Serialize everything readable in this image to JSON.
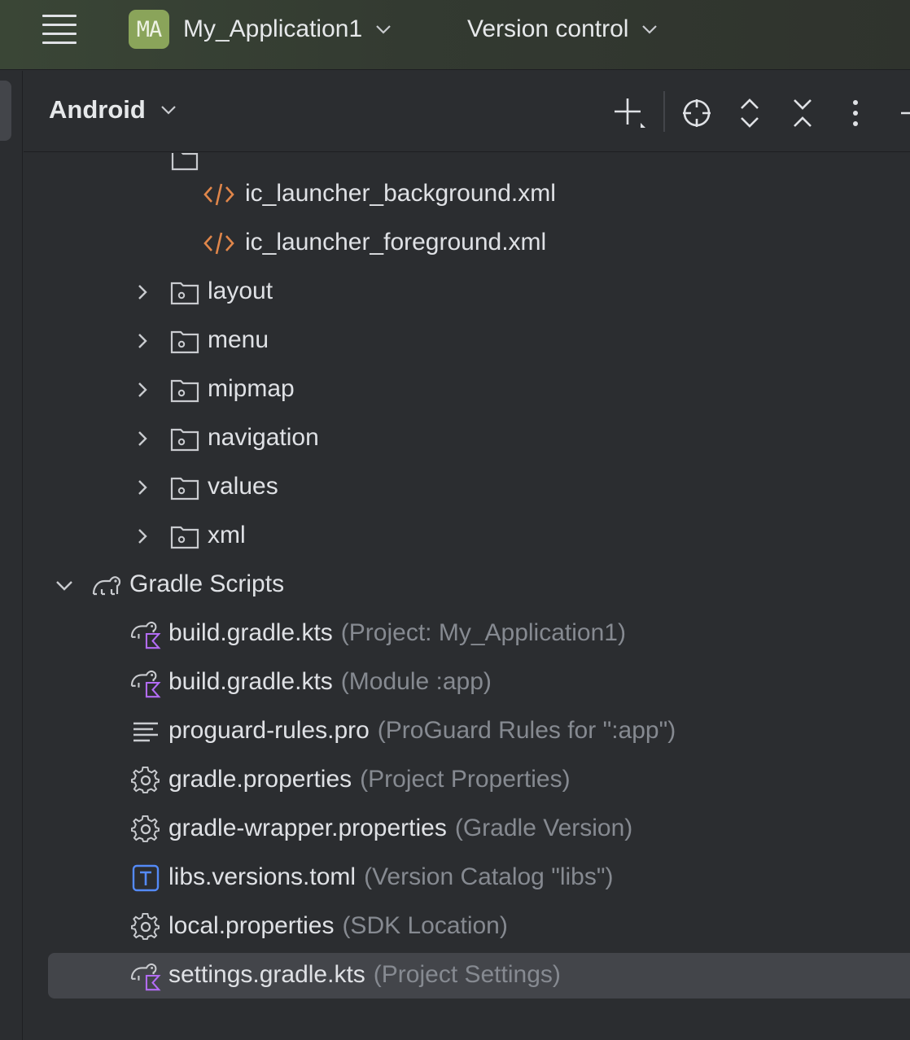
{
  "titlebar": {
    "project_badge": "MA",
    "project_name": "My_Application1",
    "vcs_label": "Version control",
    "background": "#35402f"
  },
  "panel": {
    "view_mode": "Android",
    "tools": [
      "add-icon",
      "locate-icon",
      "expand-collapse-icon",
      "collapse-all-icon",
      "more-icon",
      "minimize-icon"
    ]
  },
  "tree": {
    "items": [
      {
        "label": "ic_launcher_background.xml",
        "hint": "",
        "icon": "xml-icon",
        "expandable": false
      },
      {
        "label": "ic_launcher_foreground.xml",
        "hint": "",
        "icon": "xml-icon",
        "expandable": false
      },
      {
        "label": "layout",
        "hint": "",
        "icon": "res-folder-icon",
        "expandable": true,
        "expanded": false
      },
      {
        "label": "menu",
        "hint": "",
        "icon": "res-folder-icon",
        "expandable": true,
        "expanded": false
      },
      {
        "label": "mipmap",
        "hint": "",
        "icon": "res-folder-icon",
        "expandable": true,
        "expanded": false
      },
      {
        "label": "navigation",
        "hint": "",
        "icon": "res-folder-icon",
        "expandable": true,
        "expanded": false
      },
      {
        "label": "values",
        "hint": "",
        "icon": "res-folder-icon",
        "expandable": true,
        "expanded": false
      },
      {
        "label": "xml",
        "hint": "",
        "icon": "res-folder-icon",
        "expandable": true,
        "expanded": false
      },
      {
        "label": "Gradle Scripts",
        "hint": "",
        "icon": "gradle-elephant-icon",
        "expandable": true,
        "expanded": true
      },
      {
        "label": "build.gradle.kts",
        "hint": "(Project: My_Application1)",
        "icon": "gradle-kts-icon",
        "expandable": false
      },
      {
        "label": "build.gradle.kts",
        "hint": "(Module :app)",
        "icon": "gradle-kts-icon",
        "expandable": false
      },
      {
        "label": "proguard-rules.pro",
        "hint": "(ProGuard Rules for \":app\")",
        "icon": "text-lines-icon",
        "expandable": false
      },
      {
        "label": "gradle.properties",
        "hint": "(Project Properties)",
        "icon": "gear-icon",
        "expandable": false
      },
      {
        "label": "gradle-wrapper.properties",
        "hint": "(Gradle Version)",
        "icon": "gear-icon",
        "expandable": false
      },
      {
        "label": "libs.versions.toml",
        "hint": "(Version Catalog \"libs\")",
        "icon": "toml-icon",
        "expandable": false
      },
      {
        "label": "local.properties",
        "hint": "(SDK Location)",
        "icon": "gear-icon",
        "expandable": false
      },
      {
        "label": "settings.gradle.kts",
        "hint": "(Project Settings)",
        "icon": "gradle-kts-icon",
        "expandable": false,
        "selected": true
      }
    ]
  },
  "colors": {
    "background": "#2b2d30",
    "selection": "#43454a",
    "text": "#dfe1e5",
    "hint": "#868a91",
    "xml_icon": "#e0864a",
    "kotlin_badge": "#b36cf5",
    "toml_icon": "#548af7"
  }
}
